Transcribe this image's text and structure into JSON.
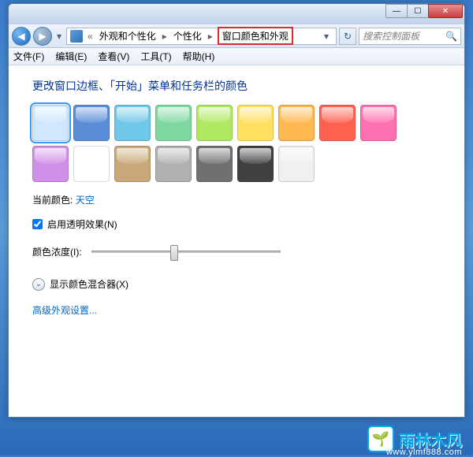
{
  "window_controls": {
    "min": "—",
    "max": "☐",
    "close": "✕"
  },
  "nav": {
    "back": "◀",
    "forward": "▶",
    "dropdown": "▾",
    "refresh": "↻"
  },
  "breadcrumb": {
    "overflow": "«",
    "items": [
      "外观和个性化",
      "个性化",
      "窗口颜色和外观"
    ],
    "dropdown": "▾"
  },
  "search": {
    "placeholder": "搜索控制面板",
    "icon": "🔍"
  },
  "menu": [
    "文件(F)",
    "编辑(E)",
    "查看(V)",
    "工具(T)",
    "帮助(H)"
  ],
  "heading": "更改窗口边框、「开始」菜单和任务栏的颜色",
  "swatches": [
    {
      "c": "#cfe8ff",
      "sel": true
    },
    {
      "c": "#5a8dd8"
    },
    {
      "c": "#6fc8e8"
    },
    {
      "c": "#7fd89f"
    },
    {
      "c": "#b0e860"
    },
    {
      "c": "#ffe060"
    },
    {
      "c": "#ffb850"
    },
    {
      "c": "#ff6050"
    },
    {
      "c": "#ff70b0"
    },
    {
      "c": "#d090e8"
    },
    {
      "c": "#ffffff"
    },
    {
      "c": "#c8a878"
    },
    {
      "c": "#b0b0b0"
    },
    {
      "c": "#707070"
    },
    {
      "c": "#404040"
    },
    {
      "c": "#f0f0f0"
    }
  ],
  "current_label": "当前颜色:",
  "current_value": "天空",
  "transparency_label": "启用透明效果(N)",
  "transparency_checked": true,
  "intensity_label": "颜色浓度(I):",
  "intensity_pct": 44,
  "mixer_label": "显示颜色混合器(X)",
  "mixer_icon": "⌄",
  "advanced_link": "高级外观设置...",
  "watermark": {
    "brand": "雨林木风",
    "url": "www.ylmf888.com",
    "leaf": "🌱"
  }
}
